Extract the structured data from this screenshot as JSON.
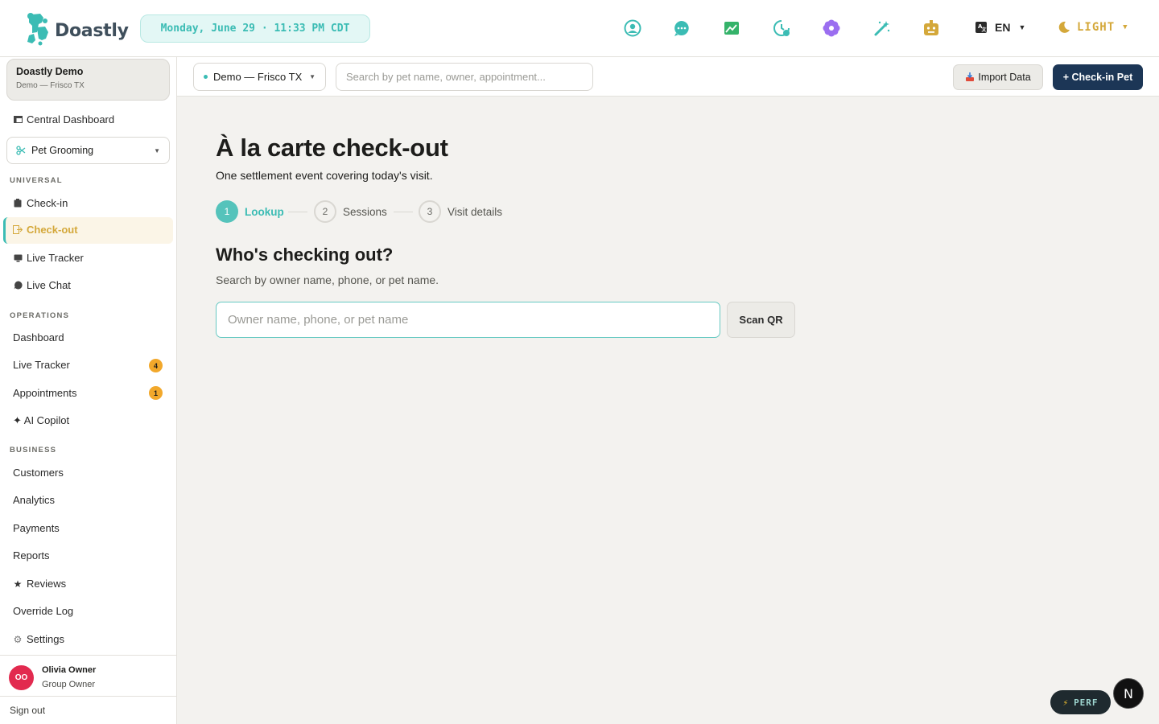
{
  "app": {
    "brand": "Doastly",
    "datetime": "Monday, June 29 · 11:33 PM CDT",
    "lang": "EN",
    "theme": "LIGHT"
  },
  "top_icons": [
    "account-circle-icon",
    "chat-bubble-icon",
    "image-chart-icon",
    "clock-history-icon",
    "flower-icon",
    "magic-wand-icon",
    "robot-icon"
  ],
  "colors": {
    "accent": "#3bbcb4",
    "navy": "#1c3656",
    "badge": "#f2a82b",
    "avatar": "#e22a4f",
    "theme_gold": "#d4a83a"
  },
  "sidebar": {
    "org_name": "Doastly Demo",
    "org_location": "Demo — Frisco TX",
    "central_dashboard": "Central Dashboard",
    "module": "Pet Grooming",
    "sections": {
      "universal": "UNIVERSAL",
      "operations": "OPERATIONS",
      "business": "BUSINESS"
    },
    "universal_items": [
      "Check-in",
      "Check-out",
      "Live Tracker",
      "Live Chat"
    ],
    "operations_items": [
      {
        "label": "Dashboard"
      },
      {
        "label": "Live Tracker",
        "badge": "4"
      },
      {
        "label": "Appointments",
        "badge": "1"
      },
      {
        "label": "✦ AI Copilot"
      }
    ],
    "business_items": [
      "Customers",
      "Analytics",
      "Payments",
      "Reports",
      "Reviews",
      "Override Log",
      "Settings"
    ],
    "user": {
      "initials": "OO",
      "name": "Olivia Owner",
      "role": "Group Owner"
    },
    "sign_out": "Sign out"
  },
  "subheader": {
    "location": "Demo — Frisco TX",
    "search_placeholder": "Search by pet name, owner, appointment...",
    "import": "Import Data",
    "checkin": "+ Check-in Pet"
  },
  "main": {
    "title": "À la carte check-out",
    "subtitle": "One settlement event covering today's visit.",
    "steps": [
      {
        "num": "1",
        "label": "Lookup"
      },
      {
        "num": "2",
        "label": "Sessions"
      },
      {
        "num": "3",
        "label": "Visit details"
      }
    ],
    "question": "Who's checking out?",
    "question_sub": "Search by owner name, phone, or pet name.",
    "lookup_placeholder": "Owner name, phone, or pet name",
    "scan": "Scan QR"
  },
  "floating": {
    "perf": "PERF",
    "n": "N"
  }
}
